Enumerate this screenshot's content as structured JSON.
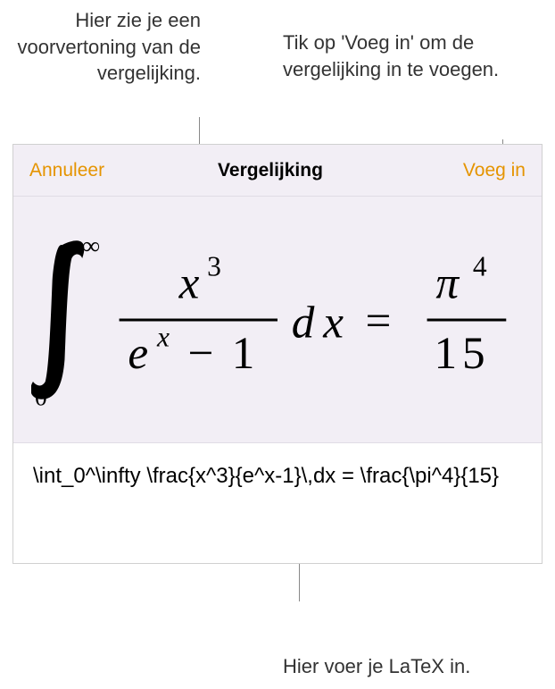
{
  "callouts": {
    "preview": "Hier zie je een voorvertoning van de vergelijking.",
    "insert": "Tik op 'Voeg in' om de vergelijking in te voegen.",
    "latex": "Hier voer je LaTeX in."
  },
  "toolbar": {
    "cancel": "Annuleer",
    "title": "Vergelijking",
    "insert": "Voeg in"
  },
  "input": {
    "latex_source": "\\int_0^\\infty \\frac{x^3}{e^x-1}\\,dx = \\frac{\\pi^4}{15}"
  },
  "colors": {
    "accent": "#e59400",
    "panel_bg": "#f2eef5"
  },
  "chart_data": {
    "type": "equation",
    "latex": "\\int_0^\\infty \\frac{x^3}{e^x-1}\\,dx = \\frac{\\pi^4}{15}",
    "description": "Definite integral from 0 to infinity of x cubed over (e to the x minus 1) dx equals pi to the fourth over 15"
  }
}
